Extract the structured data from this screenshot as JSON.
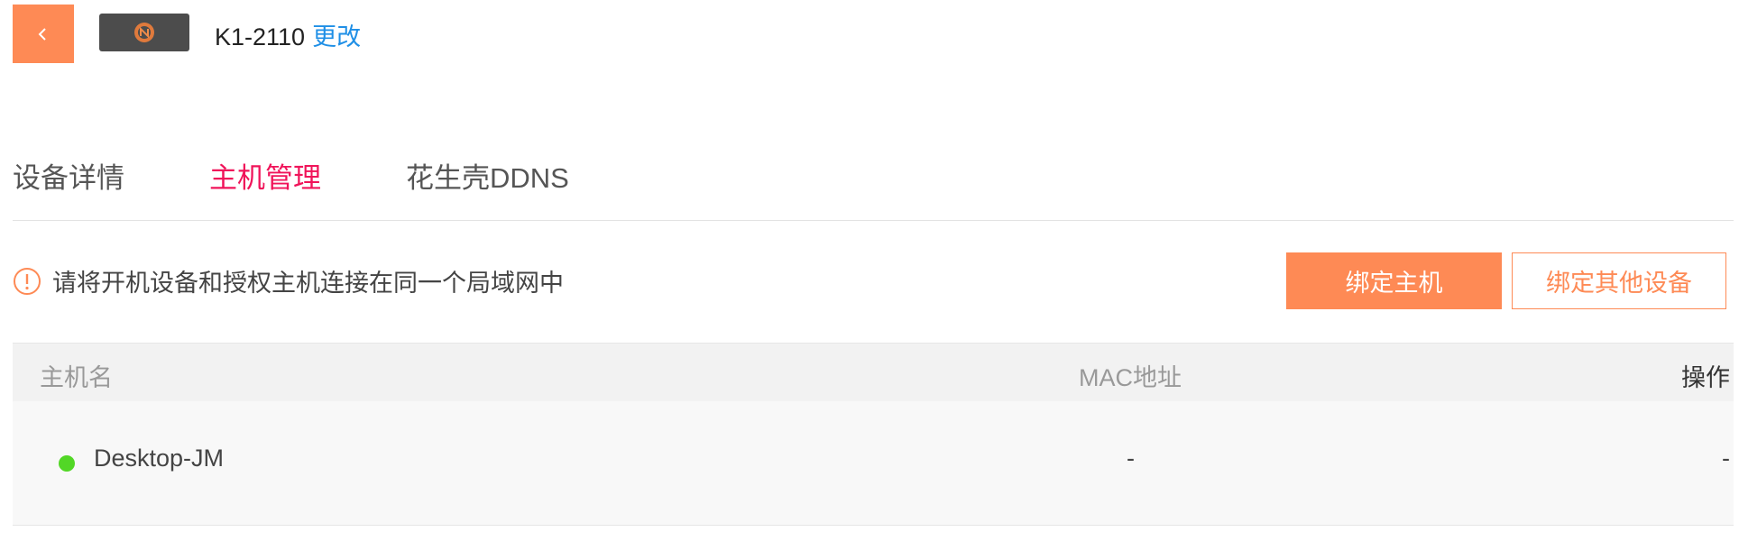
{
  "header": {
    "back_icon": "chevron-left-icon",
    "device_logo_icon": "device-logo-icon",
    "device_name": "K1-2110",
    "change_label": "更改"
  },
  "tabs": [
    {
      "label": "设备详情",
      "active": false
    },
    {
      "label": "主机管理",
      "active": true
    },
    {
      "label": "花生壳DDNS",
      "active": false
    }
  ],
  "notice": {
    "icon": "info-circle-icon",
    "text": "请将开机设备和授权主机连接在同一个局域网中"
  },
  "actions": {
    "bind_host": "绑定主机",
    "bind_other": "绑定其他设备"
  },
  "table": {
    "columns": [
      "主机名",
      "MAC地址",
      "操作"
    ],
    "rows": [
      {
        "status": "online",
        "status_color": "#52d726",
        "name": "Desktop-JM",
        "mac": "-",
        "action": "-"
      }
    ]
  },
  "colors": {
    "accent": "#fe8a55",
    "active_tab": "#f0145a",
    "link": "#1f8fe6",
    "online": "#52d726"
  }
}
